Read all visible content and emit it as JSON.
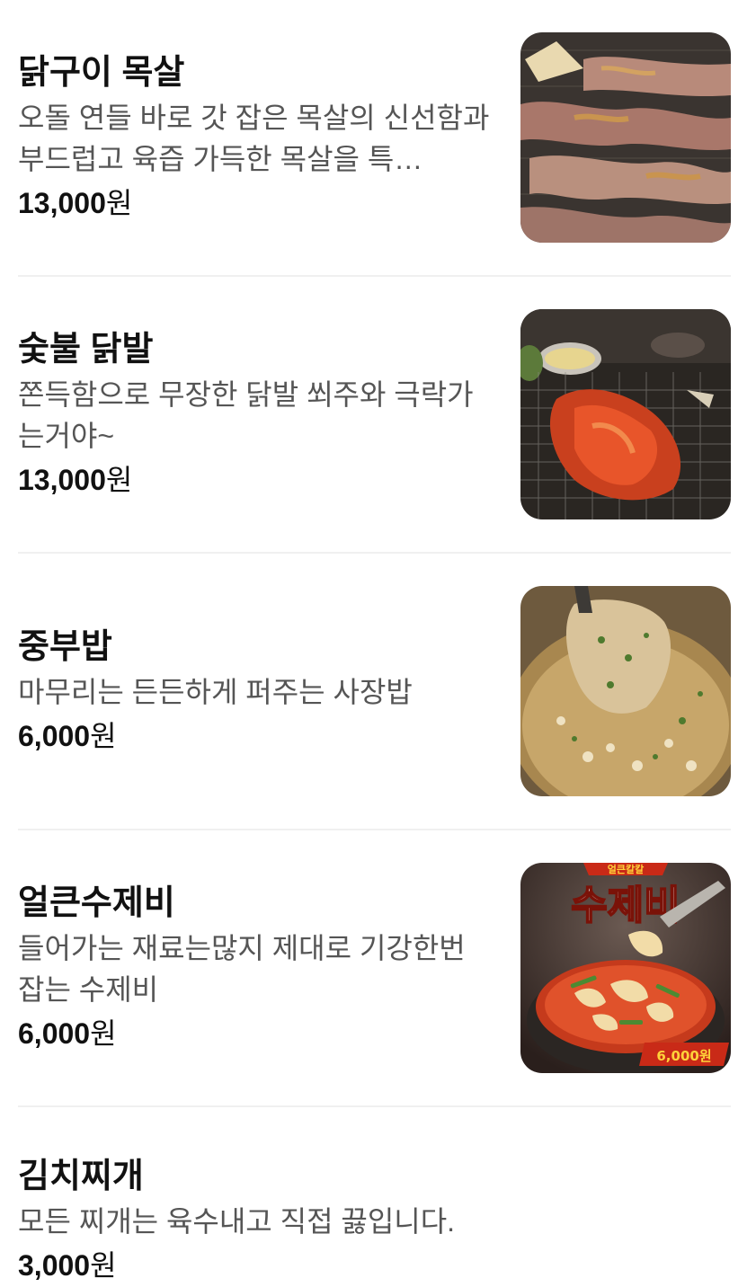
{
  "menu": {
    "items": [
      {
        "name": "닭구이 목살",
        "description": "오돌 연들 바로 갓 잡은 목살의 신선함과 부드럽고 육즙 가득한 목살을 특…",
        "price": "13,000",
        "currency": "원",
        "image_icon": "grilled-chicken-neck-photo"
      },
      {
        "name": "숯불 닭발",
        "description": "쫀득함으로 무장한 닭발 쐬주와 극락가는거야~",
        "price": "13,000",
        "currency": "원",
        "image_icon": "charcoal-chicken-feet-photo"
      },
      {
        "name": "중부밥",
        "description": "마무리는 든든하게 퍼주는 사장밥",
        "price": "6,000",
        "currency": "원",
        "image_icon": "fried-rice-pan-photo"
      },
      {
        "name": "얼큰수제비",
        "description": "들어가는 재료는많지 제대로 기강한번 잡는 수제비",
        "price": "6,000",
        "currency": "원",
        "image_icon": "spicy-sujebi-photo",
        "image_banner_title": "수제비",
        "image_banner_top": "얼큰칼칼",
        "image_price_tag": "6,000원"
      },
      {
        "name": "김치찌개",
        "description": "모든 찌개는 육수내고 직접 끓입니다.",
        "price": "3,000",
        "currency": "원"
      }
    ]
  }
}
